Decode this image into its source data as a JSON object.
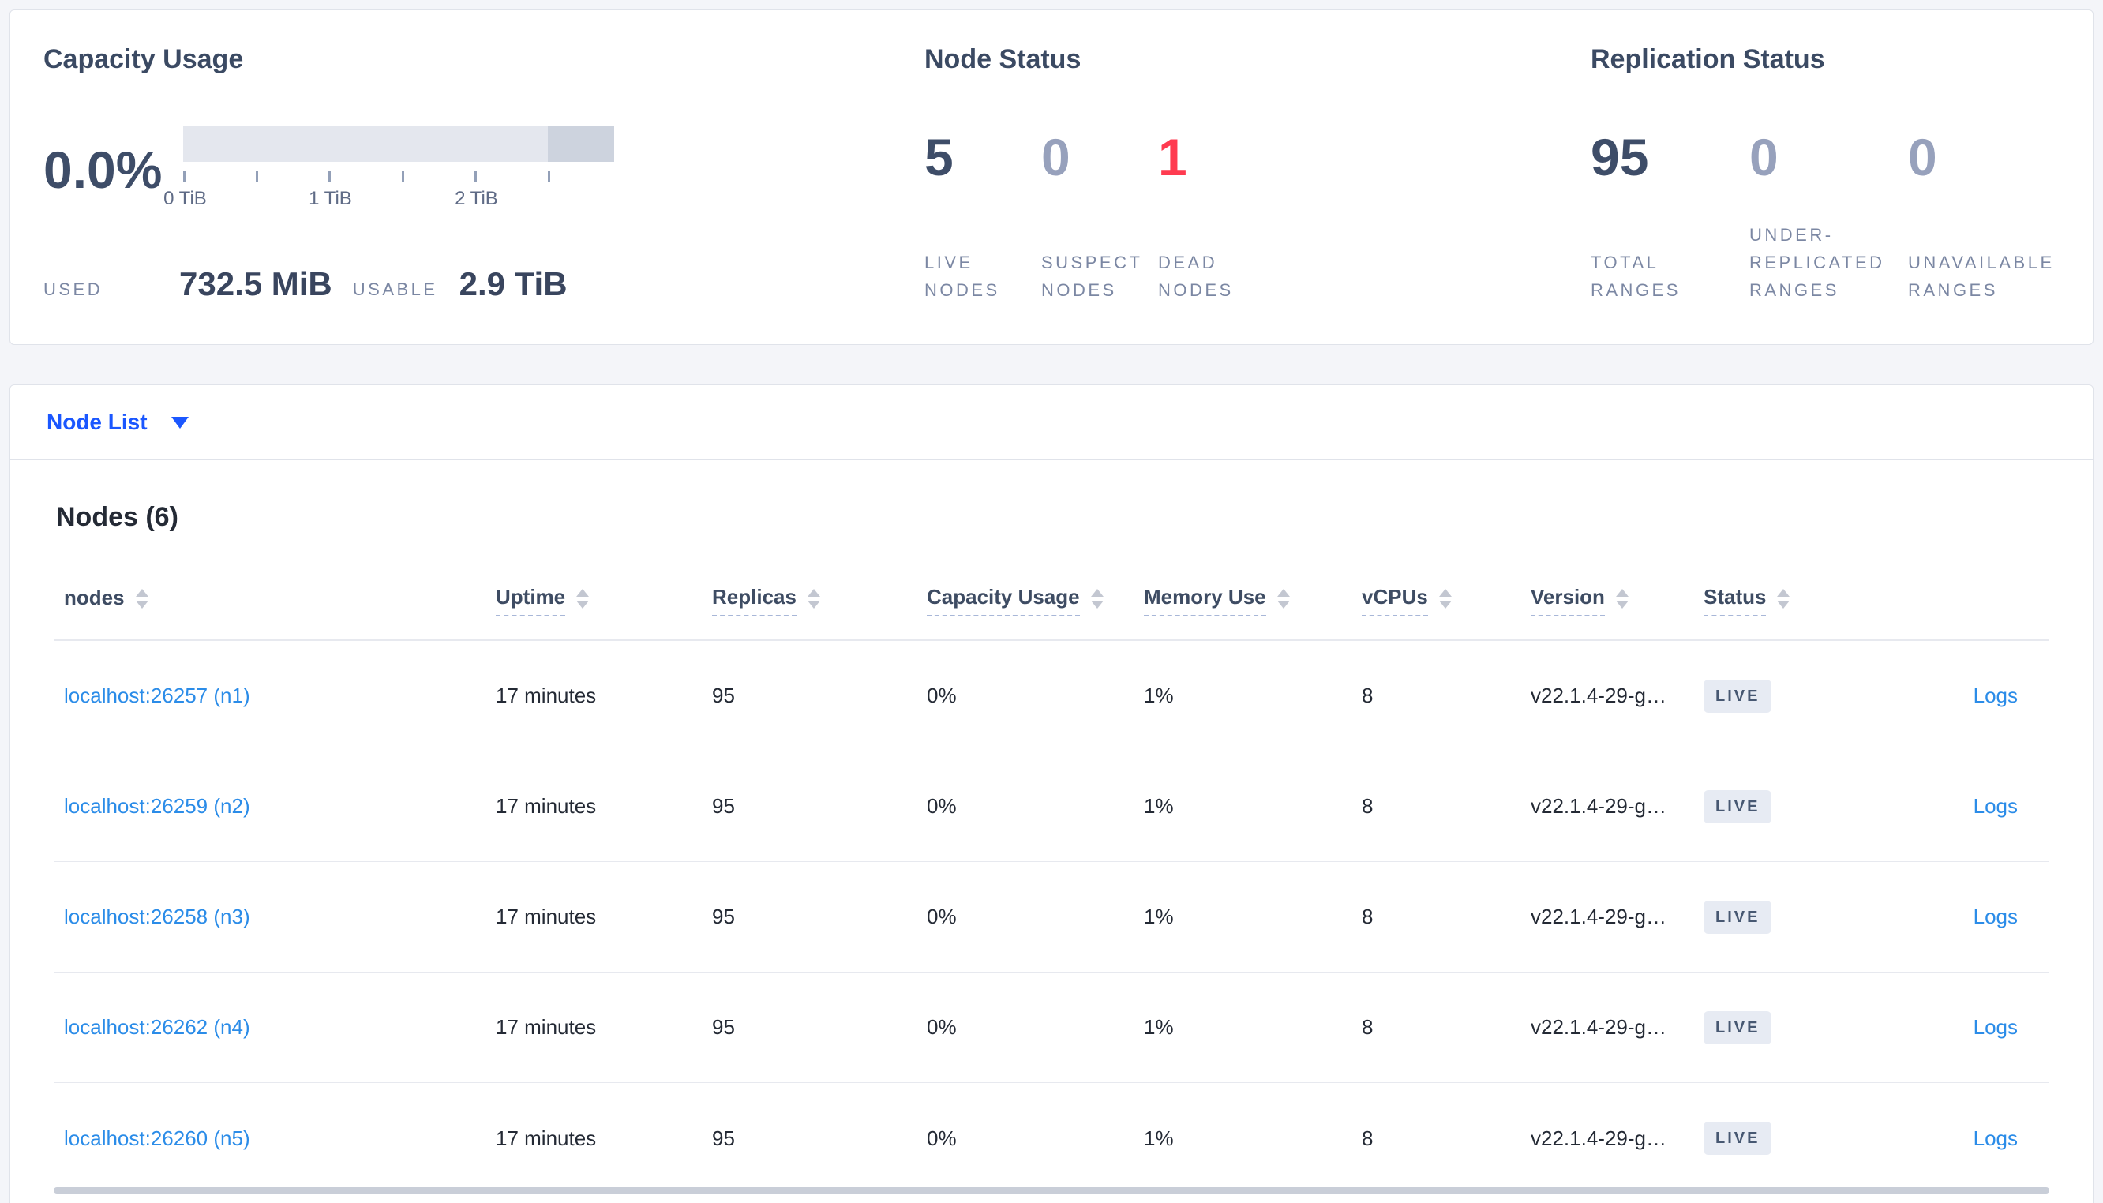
{
  "summary": {
    "capacity": {
      "title": "Capacity Usage",
      "percent": "0.0%",
      "tick_labels": [
        "0 TiB",
        "1 TiB",
        "2 TiB"
      ],
      "used_label": "USED",
      "used_value": "732.5 MiB",
      "usable_label": "USABLE",
      "usable_value": "2.9 TiB"
    },
    "node_status": {
      "title": "Node Status",
      "stats": [
        {
          "value": "5",
          "label": "LIVE NODES"
        },
        {
          "value": "0",
          "label": "SUSPECT NODES"
        },
        {
          "value": "1",
          "label": "DEAD NODES"
        }
      ]
    },
    "replication": {
      "title": "Replication Status",
      "stats": [
        {
          "value": "95",
          "label": "TOTAL RANGES"
        },
        {
          "value": "0",
          "label": "UNDER-REPLICATED RANGES"
        },
        {
          "value": "0",
          "label": "UNAVAILABLE RANGES"
        }
      ]
    }
  },
  "view_selector": {
    "label": "Node List"
  },
  "nodes_table": {
    "title": "Nodes (6)",
    "columns": [
      {
        "label": "nodes"
      },
      {
        "label": "Uptime"
      },
      {
        "label": "Replicas"
      },
      {
        "label": "Capacity Usage"
      },
      {
        "label": "Memory Use"
      },
      {
        "label": "vCPUs"
      },
      {
        "label": "Version"
      },
      {
        "label": "Status"
      }
    ],
    "rows": [
      {
        "node": "localhost:26257 (n1)",
        "uptime": "17 minutes",
        "replicas": "95",
        "capacity_usage": "0%",
        "memory_use": "1%",
        "vcpus": "8",
        "version": "v22.1.4-29-g…",
        "status": "LIVE",
        "logs": "Logs"
      },
      {
        "node": "localhost:26259 (n2)",
        "uptime": "17 minutes",
        "replicas": "95",
        "capacity_usage": "0%",
        "memory_use": "1%",
        "vcpus": "8",
        "version": "v22.1.4-29-g…",
        "status": "LIVE",
        "logs": "Logs"
      },
      {
        "node": "localhost:26258 (n3)",
        "uptime": "17 minutes",
        "replicas": "95",
        "capacity_usage": "0%",
        "memory_use": "1%",
        "vcpus": "8",
        "version": "v22.1.4-29-g…",
        "status": "LIVE",
        "logs": "Logs"
      },
      {
        "node": "localhost:26262 (n4)",
        "uptime": "17 minutes",
        "replicas": "95",
        "capacity_usage": "0%",
        "memory_use": "1%",
        "vcpus": "8",
        "version": "v22.1.4-29-g…",
        "status": "LIVE",
        "logs": "Logs"
      },
      {
        "node": "localhost:26260 (n5)",
        "uptime": "17 minutes",
        "replicas": "95",
        "capacity_usage": "0%",
        "memory_use": "1%",
        "vcpus": "8",
        "version": "v22.1.4-29-g…",
        "status": "LIVE",
        "logs": "Logs"
      }
    ]
  },
  "colors": {
    "accent_blue": "#1b57ff",
    "link_blue": "#2b8ce8",
    "danger_red": "#ff3b50",
    "stat_dark": "#3e4d68",
    "stat_muted": "#97a1bc",
    "badge_bg": "#e7ebf3",
    "badge_text": "#475872",
    "bar_light": "#e4e7ee",
    "bar_dark": "#cdd3de"
  }
}
